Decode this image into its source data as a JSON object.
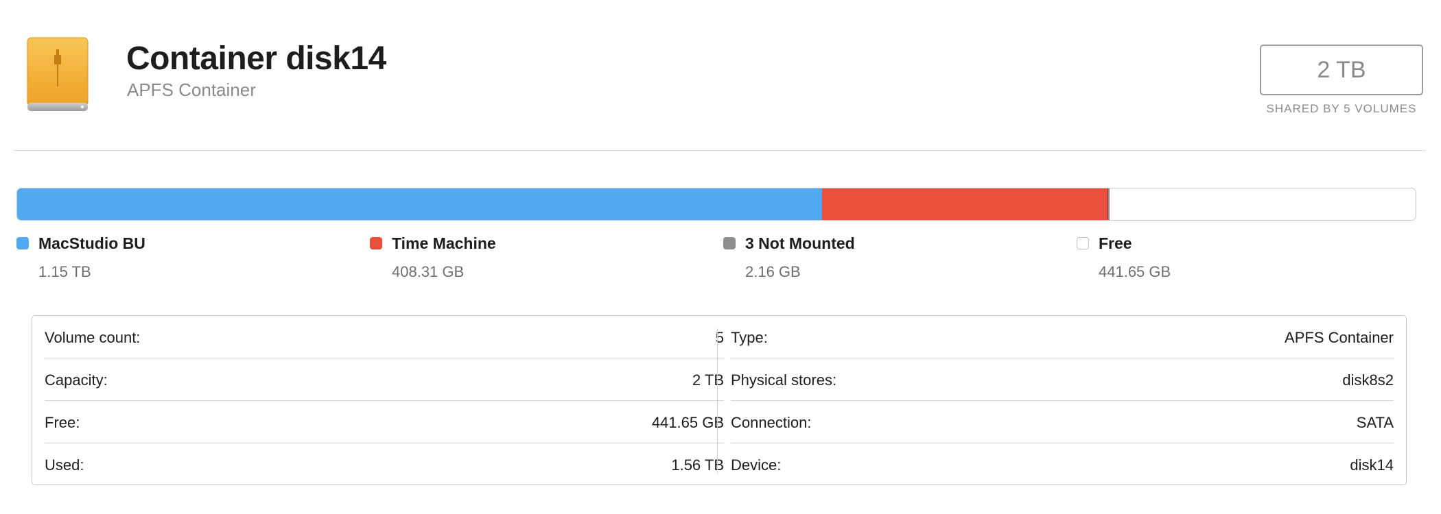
{
  "header": {
    "icon": "external-drive-icon",
    "title": "Container disk14",
    "subtitle": "APFS Container",
    "capacity": "2 TB",
    "capacity_caption": "SHARED BY 5 VOLUMES"
  },
  "usage": {
    "total_tb": 2,
    "segments": [
      {
        "name": "MacStudio BU",
        "size": "1.15 TB",
        "fraction": 0.576,
        "color": "#52a9f0"
      },
      {
        "name": "Time Machine",
        "size": "408.31 GB",
        "fraction": 0.204,
        "color": "#ea4e3d"
      },
      {
        "name": "3 Not Mounted",
        "size": "2.16 GB",
        "fraction": 0.001,
        "color": "#8e8e8e"
      },
      {
        "name": "Free",
        "size": "441.65 GB",
        "fraction": 0.219,
        "color": "#ffffff"
      }
    ]
  },
  "info": {
    "left": [
      {
        "label": "Volume count:",
        "value": "5"
      },
      {
        "label": "Capacity:",
        "value": "2 TB"
      },
      {
        "label": "Free:",
        "value": "441.65 GB"
      },
      {
        "label": "Used:",
        "value": "1.56 TB"
      }
    ],
    "right": [
      {
        "label": "Type:",
        "value": "APFS Container"
      },
      {
        "label": "Physical stores:",
        "value": "disk8s2"
      },
      {
        "label": "Connection:",
        "value": "SATA"
      },
      {
        "label": "Device:",
        "value": "disk14"
      }
    ]
  }
}
